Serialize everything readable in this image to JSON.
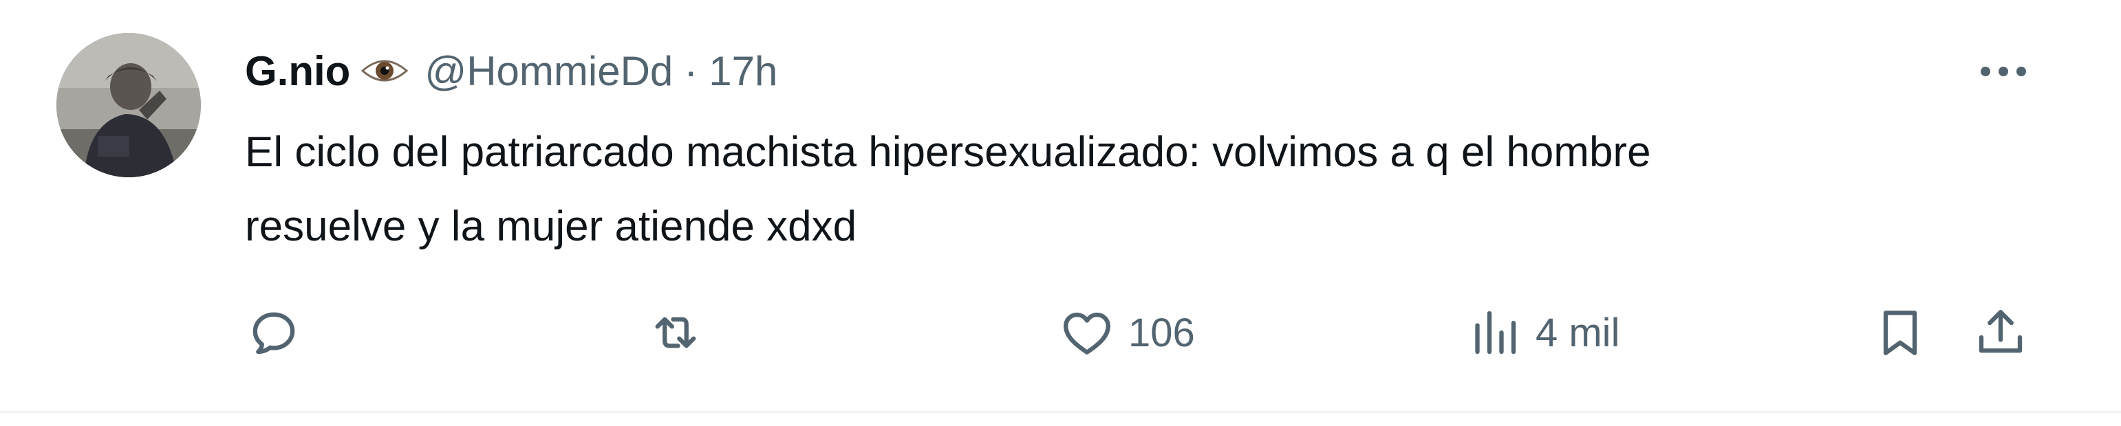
{
  "tweet": {
    "display_name": "G.nio",
    "name_emoji": "eye",
    "handle": "@HommieDd",
    "separator": "·",
    "time": "17h",
    "text_lines": [
      "El ciclo del patriarcado machista hipersexualizado: volvimos a q el hombre",
      "resuelve y la mujer atiende xdxd"
    ]
  },
  "actions": {
    "reply_icon": "reply-icon",
    "retweet_icon": "retweet-icon",
    "like_icon": "heart-icon",
    "like_count": "106",
    "views_icon": "views-icon",
    "views_count": "4 mil",
    "bookmark_icon": "bookmark-icon",
    "share_icon": "share-icon",
    "more_icon": "more-icon"
  },
  "colors": {
    "text_primary": "#0f1419",
    "text_secondary": "#536471",
    "border": "#eff3f4",
    "background": "#ffffff"
  }
}
